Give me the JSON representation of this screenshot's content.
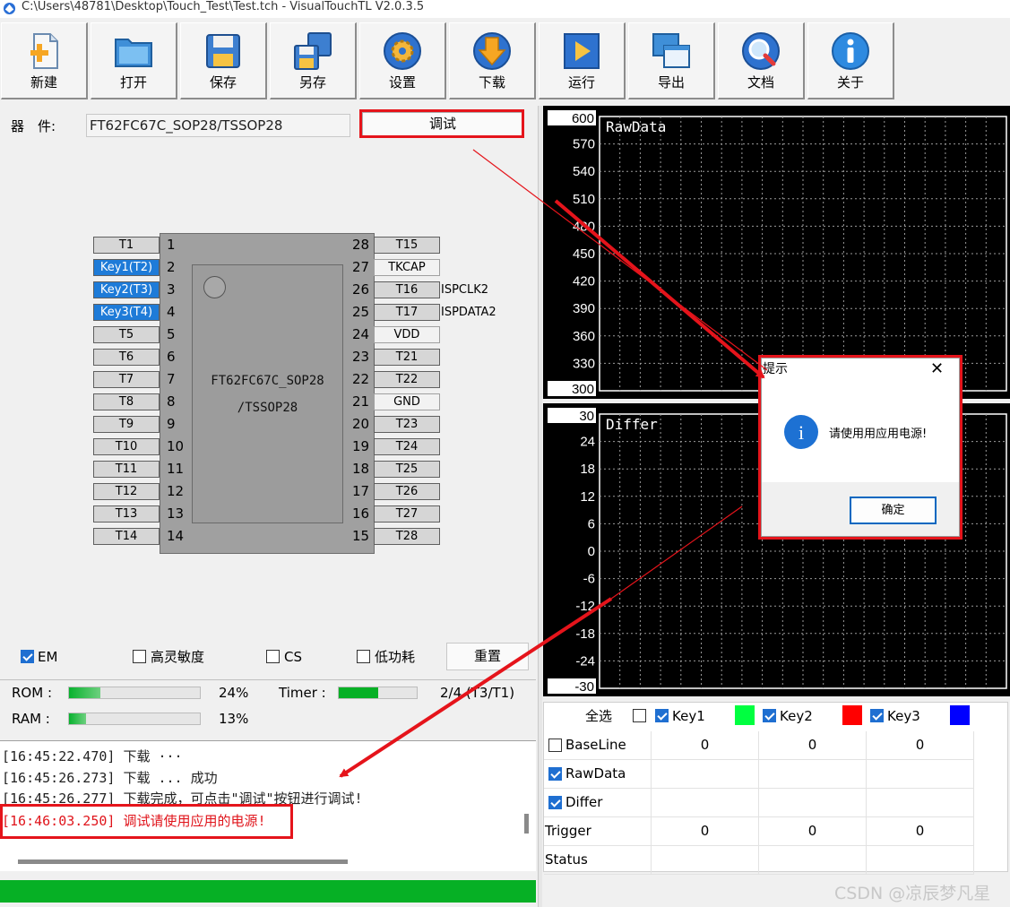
{
  "window": {
    "title": "C:\\Users\\48781\\Desktop\\Touch_Test\\Test.tch - VisualTouchTL V2.0.3.5"
  },
  "toolbar": {
    "buttons": [
      {
        "label": "新建",
        "icon": "new-file-icon"
      },
      {
        "label": "打开",
        "icon": "open-folder-icon"
      },
      {
        "label": "保存",
        "icon": "save-icon"
      },
      {
        "label": "另存",
        "icon": "save-as-icon"
      },
      {
        "label": "设置",
        "icon": "settings-gear-icon"
      },
      {
        "label": "下载",
        "icon": "download-icon"
      },
      {
        "label": "运行",
        "icon": "run-icon"
      },
      {
        "label": "导出",
        "icon": "export-icon"
      },
      {
        "label": "文档",
        "icon": "document-icon"
      },
      {
        "label": "关于",
        "icon": "about-icon"
      }
    ]
  },
  "device": {
    "label": "器　件:",
    "value": "FT62FC67C_SOP28/TSSOP28",
    "debug_label": "调试"
  },
  "chip": {
    "name_line1": "FT62FC67C_SOP28",
    "name_line2": "/TSSOP28",
    "left_pins": [
      {
        "num": "1",
        "label": "T1",
        "style": "gray"
      },
      {
        "num": "2",
        "label": "Key1(T2)",
        "style": "blue"
      },
      {
        "num": "3",
        "label": "Key2(T3)",
        "style": "blue"
      },
      {
        "num": "4",
        "label": "Key3(T4)",
        "style": "blue"
      },
      {
        "num": "5",
        "label": "T5",
        "style": "gray"
      },
      {
        "num": "6",
        "label": "T6",
        "style": "gray"
      },
      {
        "num": "7",
        "label": "T7",
        "style": "gray"
      },
      {
        "num": "8",
        "label": "T8",
        "style": "gray"
      },
      {
        "num": "9",
        "label": "T9",
        "style": "gray"
      },
      {
        "num": "10",
        "label": "T10",
        "style": "gray"
      },
      {
        "num": "11",
        "label": "T11",
        "style": "gray"
      },
      {
        "num": "12",
        "label": "T12",
        "style": "gray"
      },
      {
        "num": "13",
        "label": "T13",
        "style": "gray"
      },
      {
        "num": "14",
        "label": "T14",
        "style": "gray"
      }
    ],
    "right_pins": [
      {
        "num": "28",
        "label": "T15",
        "style": "gray",
        "fn": ""
      },
      {
        "num": "27",
        "label": "TKCAP",
        "style": "light",
        "fn": ""
      },
      {
        "num": "26",
        "label": "T16",
        "style": "gray",
        "fn": "ISPCLK2"
      },
      {
        "num": "25",
        "label": "T17",
        "style": "gray",
        "fn": "ISPDATA2"
      },
      {
        "num": "24",
        "label": "VDD",
        "style": "light",
        "fn": ""
      },
      {
        "num": "23",
        "label": "T21",
        "style": "gray",
        "fn": ""
      },
      {
        "num": "22",
        "label": "T22",
        "style": "gray",
        "fn": ""
      },
      {
        "num": "21",
        "label": "GND",
        "style": "light",
        "fn": ""
      },
      {
        "num": "20",
        "label": "T23",
        "style": "gray",
        "fn": ""
      },
      {
        "num": "19",
        "label": "T24",
        "style": "gray",
        "fn": ""
      },
      {
        "num": "18",
        "label": "T25",
        "style": "gray",
        "fn": ""
      },
      {
        "num": "17",
        "label": "T26",
        "style": "gray",
        "fn": ""
      },
      {
        "num": "16",
        "label": "T27",
        "style": "gray",
        "fn": ""
      },
      {
        "num": "15",
        "label": "T28",
        "style": "gray",
        "fn": ""
      }
    ]
  },
  "options": {
    "em": {
      "label": "EM",
      "checked": true
    },
    "high_sens": {
      "label": "高灵敏度",
      "checked": false
    },
    "cs": {
      "label": "CS",
      "checked": false
    },
    "low_power": {
      "label": "低功耗",
      "checked": false
    },
    "reset_label": "重置"
  },
  "resources": {
    "rom": {
      "label": "ROM :",
      "percent": 24,
      "text": "24%"
    },
    "ram": {
      "label": "RAM :",
      "percent": 13,
      "text": "13%"
    },
    "timer": {
      "label": "Timer :",
      "fraction": 0.5,
      "text": "2/4 (T3/T1)"
    }
  },
  "log": {
    "lines": [
      {
        "text": "[16:45:22.470] 下载 ···",
        "error": false
      },
      {
        "text": "[16:45:26.273] 下载 ... 成功",
        "error": false
      },
      {
        "text": "[16:45:26.277] 下载完成，可点击\"调试\"按钮进行调试!",
        "error": false
      },
      {
        "text": "[16:46:03.250] 调试请使用应用的电源!",
        "error": true
      }
    ]
  },
  "status_progress": 1.0,
  "charts": {
    "rawdata": {
      "title": "RawData",
      "ymax_box": "600",
      "ymin_box": "300",
      "ticks": [
        "570",
        "540",
        "510",
        "480",
        "450",
        "420",
        "390",
        "360",
        "330"
      ]
    },
    "differ": {
      "title": "Differ",
      "ymax_box": "30",
      "ymin_box": "-30",
      "ticks": [
        "24",
        "18",
        "12",
        "6",
        "0",
        "-6",
        "-12",
        "-18",
        "-24"
      ]
    }
  },
  "chart_data": [
    {
      "type": "line",
      "title": "RawData",
      "ylim": [
        300,
        600
      ],
      "grid": true,
      "series": []
    },
    {
      "type": "line",
      "title": "Differ",
      "ylim": [
        -30,
        30
      ],
      "grid": true,
      "series": []
    }
  ],
  "channels": {
    "select_all": "全选",
    "select_all_checked": false,
    "keys": [
      {
        "label": "Key1",
        "checked": true,
        "color": "#00ff40"
      },
      {
        "label": "Key2",
        "checked": true,
        "color": "#ff0000"
      },
      {
        "label": "Key3",
        "checked": true,
        "color": "#0000ff"
      }
    ],
    "rows": [
      {
        "label": "BaseLine",
        "has_checkbox": true,
        "checked": false,
        "values": [
          "0",
          "0",
          "0"
        ]
      },
      {
        "label": "RawData",
        "has_checkbox": true,
        "checked": true,
        "values": [
          "",
          "",
          ""
        ]
      },
      {
        "label": "Differ",
        "has_checkbox": true,
        "checked": true,
        "values": [
          "",
          "",
          ""
        ]
      },
      {
        "label": "Trigger",
        "has_checkbox": false,
        "checked": false,
        "values": [
          "0",
          "0",
          "0"
        ]
      },
      {
        "label": "Status",
        "has_checkbox": false,
        "checked": false,
        "values": [
          "",
          "",
          ""
        ]
      }
    ]
  },
  "dialog": {
    "title": "提示",
    "message": "请使用用应用电源!",
    "ok_label": "确定",
    "close_glyph": "✕",
    "info_glyph": "i"
  },
  "watermark": "CSDN @凉辰梦凡星",
  "colors": {
    "annotation_red": "#e5141b",
    "progress_green": "#06b025",
    "selected_blue": "#1e7bd8"
  }
}
